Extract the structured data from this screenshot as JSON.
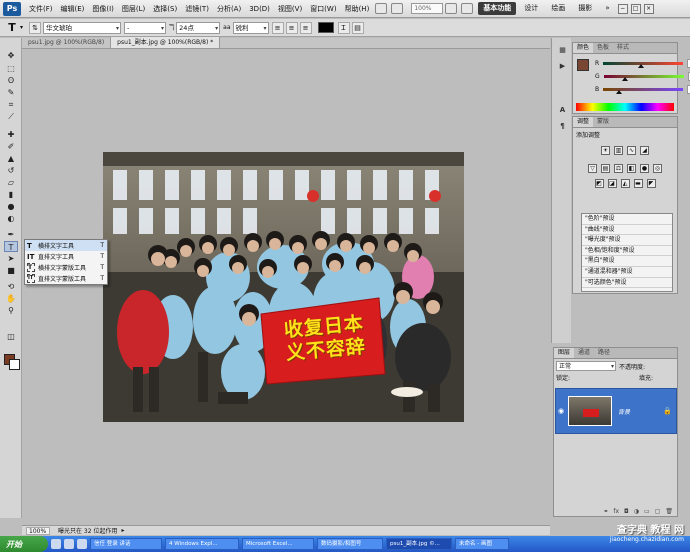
{
  "menubar": {
    "logo": "Ps",
    "items": [
      "文件(F)",
      "编辑(E)",
      "图像(I)",
      "图层(L)",
      "选择(S)",
      "滤镜(T)",
      "分析(A)",
      "3D(D)",
      "视图(V)",
      "窗口(W)",
      "帮助(H)"
    ],
    "zoom": "100%",
    "workspaces": [
      "基本功能",
      "设计",
      "绘画",
      "摄影"
    ],
    "more": "»"
  },
  "options": {
    "tool_glyph": "T",
    "font_family": "华文琥珀",
    "font_style": "-",
    "font_size": "24点",
    "antialias": "锐利",
    "text_color": "#000000"
  },
  "documents": {
    "tabs": [
      "psu1.jpg @ 100%(RGB/8)",
      "psu1_副本.jpg @ 100%(RGB/8) *"
    ],
    "active_tab": 1
  },
  "type_flyout": {
    "items": [
      {
        "label": "横排文字工具",
        "key": "T",
        "glyph": "T"
      },
      {
        "label": "直排文字工具",
        "key": "T",
        "glyph": "IT"
      },
      {
        "label": "横排文字蒙版工具",
        "key": "T",
        "glyph": "T"
      },
      {
        "label": "直排文字蒙版工具",
        "key": "T",
        "glyph": "IT"
      }
    ]
  },
  "photo": {
    "banner_line1": "收复日本",
    "banner_line2": "义不容辞"
  },
  "status": {
    "zoom": "100%",
    "info": "曝光只在 32 位起作用"
  },
  "color_panel": {
    "tabs": [
      "颜色",
      "色板",
      "样式"
    ],
    "channels": [
      {
        "label": "R",
        "value": "121",
        "level": 0.47
      },
      {
        "label": "G",
        "value": "70",
        "level": 0.27
      },
      {
        "label": "B",
        "value": "51",
        "level": 0.2
      }
    ],
    "swatch_color": "#794633"
  },
  "adjust_panel": {
    "tabs": [
      "调整",
      "蒙版"
    ],
    "title": "添加调整",
    "presets": [
      "\"色阶\"预设",
      "\"曲线\"预设",
      "\"曝光度\"预设",
      "\"色相/饱和度\"预设",
      "\"黑白\"预设",
      "\"通道混和器\"预设",
      "\"可选颜色\"预设"
    ]
  },
  "layers_panel": {
    "tabs": [
      "图层",
      "通道",
      "路径"
    ],
    "blend_mode": "正常",
    "opacity_label": "不透明度:",
    "lock_label": "锁定:",
    "fill_label": "填充:",
    "layer_name": "背景"
  },
  "taskbar": {
    "start": "开始",
    "tasks": [
      "信任 登录 讲话",
      "4 Windows Expl...",
      "Microsoft Excel...",
      "数码摄影/和图号",
      "psu1_副本.jpg ©...",
      "未命名 - 画图"
    ],
    "active_task": 4
  },
  "watermark": {
    "line1": "查字典 教程 网",
    "line2": "jiaocheng.chazidian.com"
  }
}
